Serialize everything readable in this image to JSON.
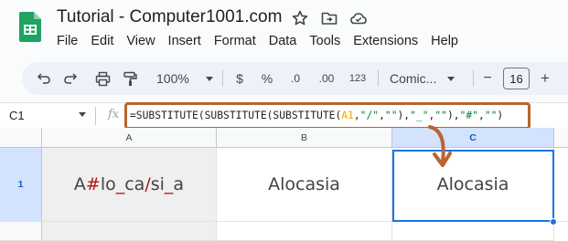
{
  "app": {
    "title": "Tutorial - Computer1001.com",
    "logo": "google-sheets-logo",
    "title_icons": [
      "star-icon",
      "move-to-folder-icon",
      "cloud-saved-icon"
    ]
  },
  "menu": [
    "File",
    "Edit",
    "View",
    "Insert",
    "Format",
    "Data",
    "Tools",
    "Extensions",
    "Help"
  ],
  "toolbar": {
    "undo": "undo-icon",
    "redo": "redo-icon",
    "print": "print-icon",
    "paint_format": "paint-format-icon",
    "zoom": "100%",
    "currency": "$",
    "percent": "%",
    "decrease_decimal": ".0",
    "increase_decimal": ".00",
    "number_format": "123",
    "font": "Comic...",
    "font_size": "16",
    "minus": "−",
    "plus": "+"
  },
  "formula_bar": {
    "name_box": "C1",
    "fx": "fx",
    "formula_parts": [
      {
        "text": "=SUBSTITUTE(SUBSTITUTE(SUBSTITUTE(",
        "kind": "plain"
      },
      {
        "text": "A1",
        "kind": "ref"
      },
      {
        "text": ",",
        "kind": "plain"
      },
      {
        "text": "\"/\"",
        "kind": "str"
      },
      {
        "text": ",",
        "kind": "plain"
      },
      {
        "text": "\"\"",
        "kind": "str"
      },
      {
        "text": "),",
        "kind": "plain"
      },
      {
        "text": "\"_\"",
        "kind": "str"
      },
      {
        "text": ",",
        "kind": "plain"
      },
      {
        "text": "\"\"",
        "kind": "str"
      },
      {
        "text": "),",
        "kind": "plain"
      },
      {
        "text": "\"#\"",
        "kind": "str"
      },
      {
        "text": ",",
        "kind": "plain"
      },
      {
        "text": "\"\"",
        "kind": "str"
      },
      {
        "text": ")",
        "kind": "plain"
      }
    ],
    "highlight_color": "#b9652e"
  },
  "grid": {
    "columns": [
      "A",
      "B",
      "C"
    ],
    "rows": [
      "1"
    ],
    "selected_cell": "C1",
    "cells": {
      "A1": {
        "text": "A#lo_ca/si_a",
        "parts": [
          {
            "text": "A",
            "red": false
          },
          {
            "text": "#",
            "red": true
          },
          {
            "text": "lo",
            "red": false
          },
          {
            "text": "_",
            "red": true
          },
          {
            "text": "ca",
            "red": false
          },
          {
            "text": "/",
            "red": true
          },
          {
            "text": "si",
            "red": false
          },
          {
            "text": "_",
            "red": true
          },
          {
            "text": "a",
            "red": false
          }
        ]
      },
      "B1": {
        "text": "Alocasia"
      },
      "C1": {
        "text": "Alocasia"
      }
    },
    "accent_color": "#1a73e8",
    "arrow_color": "#b9652e"
  }
}
